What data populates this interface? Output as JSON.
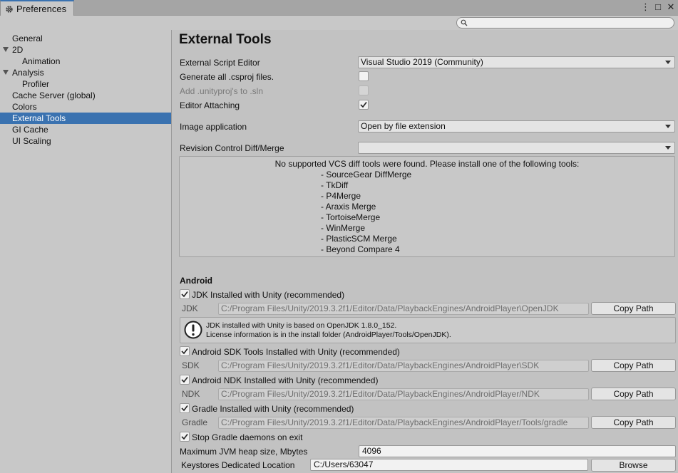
{
  "window": {
    "tab_title": "Preferences",
    "controls": [
      "⋮",
      "□",
      "✕"
    ]
  },
  "search": {
    "placeholder": ""
  },
  "sidebar": {
    "items": [
      {
        "label": "General",
        "indent": 0,
        "expandable": false,
        "active": false
      },
      {
        "label": "2D",
        "indent": 0,
        "expandable": true,
        "active": false
      },
      {
        "label": "Animation",
        "indent": 1,
        "expandable": false,
        "active": false
      },
      {
        "label": "Analysis",
        "indent": 0,
        "expandable": true,
        "active": false
      },
      {
        "label": "Profiler",
        "indent": 1,
        "expandable": false,
        "active": false
      },
      {
        "label": "Cache Server (global)",
        "indent": 0,
        "expandable": false,
        "active": false
      },
      {
        "label": "Colors",
        "indent": 0,
        "expandable": false,
        "active": false
      },
      {
        "label": "External Tools",
        "indent": 0,
        "expandable": false,
        "active": true
      },
      {
        "label": "GI Cache",
        "indent": 0,
        "expandable": false,
        "active": false
      },
      {
        "label": "UI Scaling",
        "indent": 0,
        "expandable": false,
        "active": false
      }
    ]
  },
  "main": {
    "title": "External Tools",
    "script_editor": {
      "label": "External Script Editor",
      "value": "Visual Studio 2019 (Community)"
    },
    "generate_csproj": {
      "label": "Generate all .csproj files.",
      "checked": false
    },
    "add_unityproj": {
      "label": "Add .unityproj's to .sln",
      "checked": false,
      "disabled": true
    },
    "editor_attaching": {
      "label": "Editor Attaching",
      "checked": true
    },
    "image_app": {
      "label": "Image application",
      "value": "Open by file extension"
    },
    "revision_control": {
      "label": "Revision Control Diff/Merge",
      "value": ""
    },
    "vcs_message": {
      "title": "No supported VCS diff tools were found. Please install one of the following tools:",
      "tools": [
        "- SourceGear DiffMerge",
        "- TkDiff",
        "- P4Merge",
        "- Araxis Merge",
        "- TortoiseMerge",
        "- WinMerge",
        "- PlasticSCM Merge",
        "- Beyond Compare 4"
      ]
    },
    "android": {
      "section": "Android",
      "jdk_check": {
        "label": "JDK Installed with Unity (recommended)",
        "checked": true
      },
      "jdk": {
        "label": "JDK",
        "path": "C:/Program Files/Unity/2019.3.2f1/Editor/Data/PlaybackEngines/AndroidPlayer\\OpenJDK",
        "button": "Copy Path"
      },
      "jdk_info_line1": "JDK installed with Unity is based on OpenJDK 1.8.0_152.",
      "jdk_info_line2": "License information is in the install folder (AndroidPlayer/Tools/OpenJDK).",
      "sdk_check": {
        "label": "Android SDK Tools Installed with Unity (recommended)",
        "checked": true
      },
      "sdk": {
        "label": "SDK",
        "path": "C:/Program Files/Unity/2019.3.2f1/Editor/Data/PlaybackEngines/AndroidPlayer\\SDK",
        "button": "Copy Path"
      },
      "ndk_check": {
        "label": "Android NDK Installed with Unity (recommended)",
        "checked": true
      },
      "ndk": {
        "label": "NDK",
        "path": "C:/Program Files/Unity/2019.3.2f1/Editor/Data/PlaybackEngines/AndroidPlayer/NDK",
        "button": "Copy Path"
      },
      "gradle_check": {
        "label": "Gradle Installed with Unity (recommended)",
        "checked": true
      },
      "gradle": {
        "label": "Gradle",
        "path": "C:/Program Files/Unity/2019.3.2f1/Editor/Data/PlaybackEngines/AndroidPlayer/Tools/gradle",
        "button": "Copy Path"
      },
      "stop_gradle": {
        "label": "Stop Gradle daemons on exit",
        "checked": true
      },
      "jvm_heap": {
        "label": "Maximum JVM heap size, Mbytes",
        "value": "4096"
      },
      "keystore": {
        "label": "Keystores Dedicated Location",
        "value": "C:/Users/63047",
        "button": "Browse"
      }
    }
  },
  "colors": {
    "accent": "#3a72b0",
    "panel": "#c2c2c2",
    "sidebar": "#c8c8c8"
  }
}
